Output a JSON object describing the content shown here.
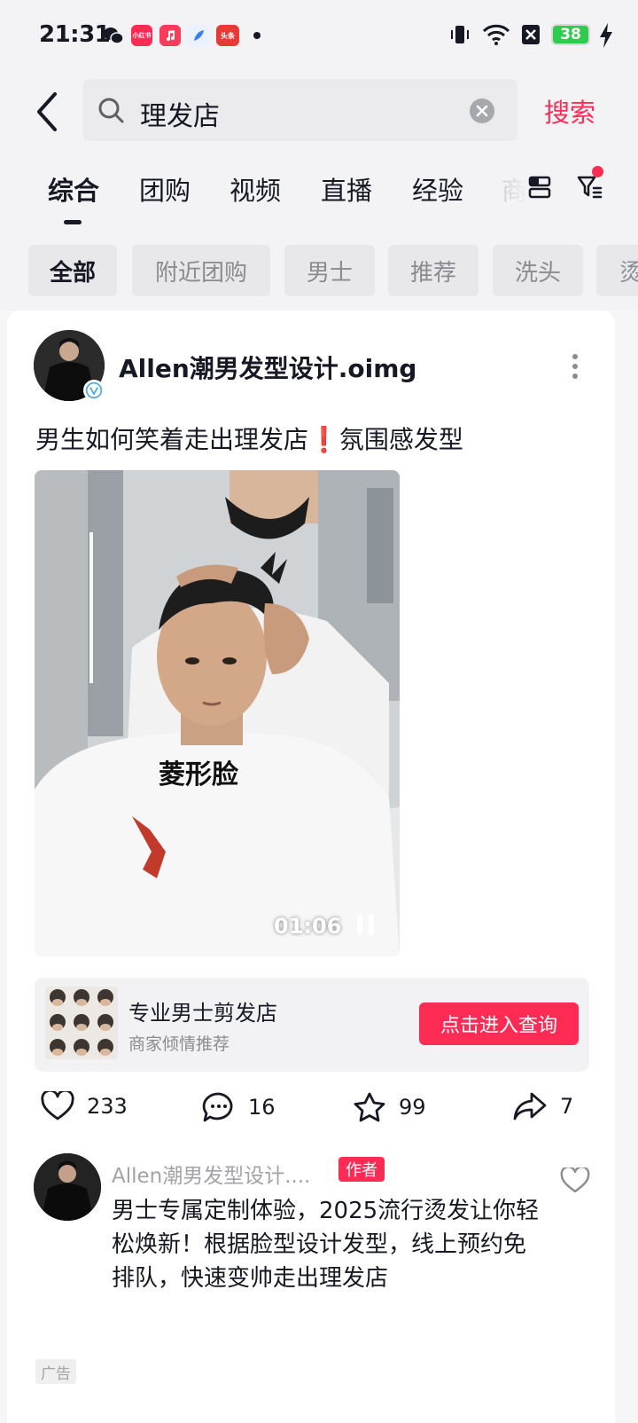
{
  "status_bar": {
    "time": "21:31",
    "battery": "38",
    "app_badges": [
      "小红书",
      "头条"
    ]
  },
  "search": {
    "query": "理发店",
    "submit_label": "搜索"
  },
  "tabs": [
    {
      "label": "综合",
      "active": true
    },
    {
      "label": "团购"
    },
    {
      "label": "视频"
    },
    {
      "label": "直播"
    },
    {
      "label": "经验"
    },
    {
      "label": "商"
    }
  ],
  "chips": [
    {
      "label": "全部",
      "active": true
    },
    {
      "label": "附近团购"
    },
    {
      "label": "男士"
    },
    {
      "label": "推荐"
    },
    {
      "label": "洗头"
    },
    {
      "label": "烫"
    }
  ],
  "post": {
    "author": "Allen潮男发型设计.oimg",
    "title_start": "男生如何笑着走出理发店",
    "title_mark": "❗",
    "title_end": "氛围感发型",
    "video": {
      "caption": "菱形脸",
      "duration": "01:06"
    },
    "shop": {
      "title": "专业男士剪发店",
      "subtitle": "商家倾情推荐",
      "button": "点击进入查询"
    },
    "stats": {
      "likes": "233",
      "comments": "16",
      "favorites": "99",
      "shares": "7"
    }
  },
  "comment": {
    "author": "Allen潮男发型设计....",
    "badge": "作者",
    "text": "男士专属定制体验，2025流行烫发让你轻松焕新！根据脸型设计发型，线上预约免排队，快速变帅走出理发店",
    "ad_label": "广告"
  },
  "colors": {
    "accent": "#fe2c55",
    "text": "#161823",
    "muted": "#8a8b91"
  }
}
